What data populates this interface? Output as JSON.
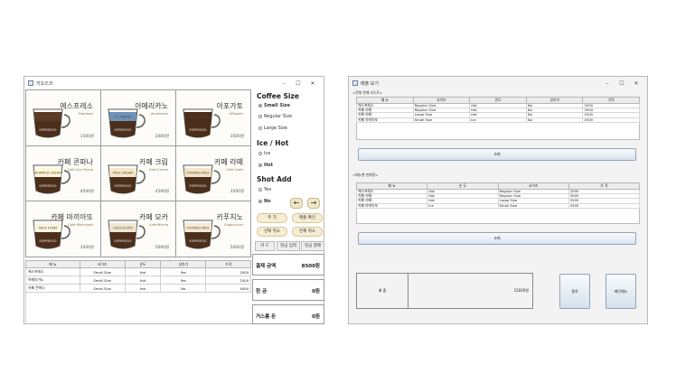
{
  "kiosk": {
    "title": "키오스크",
    "menu": [
      {
        "name": "에스프레소",
        "eng": "Espresso",
        "price": "1500원",
        "cup_label": "HYPHEN",
        "cup_top": "#5a3a22"
      },
      {
        "name": "아메리카노",
        "eng": "Americano",
        "price": "2000원",
        "cup_label": "ICE WATER",
        "cup_top": "#6e93b8"
      },
      {
        "name": "아포가토",
        "eng": "Affogato",
        "price": "3500원",
        "cup_label": "ICE CREAM",
        "cup_top": "#4a2e1b"
      },
      {
        "name": "카페 콘파나",
        "eng": "Cafe Con Panna",
        "price": "4500원",
        "cup_label": "WHIPPED CREAM",
        "cup_top": "#fff7d6"
      },
      {
        "name": "카페 크림",
        "eng": "Cafe Creme",
        "price": "4500원",
        "cup_label": "MILK CREAM",
        "cup_top": "#f5e7c7"
      },
      {
        "name": "카페 라떼",
        "eng": "Cafe Latte",
        "price": "3500원",
        "cup_label": "FOAMED MILK",
        "cup_top": "#f3e4c4"
      },
      {
        "name": "카페 마끼아또",
        "eng": "Cafe Macchiato",
        "price": "3500원",
        "cup_label": "MILK FOAM",
        "cup_top": "#faf3e2"
      },
      {
        "name": "카페 모카",
        "eng": "Cafe Mocha",
        "price": "5000원",
        "cup_label": "CHOCOLATE",
        "cup_top": "#f0e6d2"
      },
      {
        "name": "카푸치노",
        "eng": "Cappuccino",
        "price": "5000원",
        "cup_label": "FOAMED MILK",
        "cup_top": "#f5e9d6"
      }
    ],
    "cup_base_label": "ESPRESSO",
    "options": {
      "size_title": "Coffee Size",
      "sizes": [
        {
          "label": "Small Size",
          "selected": true
        },
        {
          "label": "Regular Size",
          "selected": false
        },
        {
          "label": "Large Size",
          "selected": false
        }
      ],
      "temp_title": "Ice / Hot",
      "temps": [
        {
          "label": "Ice",
          "selected": false
        },
        {
          "label": "Hot",
          "selected": true
        }
      ],
      "shot_title": "Shot Add",
      "shots": [
        {
          "label": "Yes",
          "selected": false
        },
        {
          "label": "No",
          "selected": true
        }
      ]
    },
    "buttons": {
      "prev": "←",
      "next": "→",
      "add": "추 가",
      "sales_check": "매출 확인",
      "cancel_selected": "선택 취소",
      "cancel_all": "전체 취소",
      "card": "카 드",
      "cash_input": "현금 입력",
      "cash_pay": "현금 결제"
    },
    "order_columns": [
      "메 뉴",
      "사이즈",
      "온도",
      "샷추가",
      "가격"
    ],
    "orders": [
      [
        "에스프레소",
        "Small Size",
        "Hot",
        "Yes",
        "2000"
      ],
      [
        "아메리카노",
        "Small Size",
        "Hot",
        "Yes",
        "2500"
      ],
      [
        "카페 콘파나",
        "Small Size",
        "Hot",
        "No",
        "4000"
      ]
    ],
    "summary": {
      "payment_label": "결제 금액",
      "payment_value": "8500원",
      "cash_label": "현 금",
      "cash_value": "0원",
      "change_label": "거스름 돈",
      "change_value": "0원"
    }
  },
  "sales": {
    "title": "매출 보기",
    "all_sales_title": "<전체 판매 리스트>",
    "all_columns": [
      "메 뉴",
      "사이즈",
      "온도",
      "샷추가",
      "가격"
    ],
    "all_rows": [
      [
        "에스프레소",
        "Regular Size",
        "Hot",
        "No",
        "2000"
      ],
      [
        "카페 라떼",
        "Regular Size",
        "Hot",
        "No",
        "3000"
      ],
      [
        "카페 라떼",
        "Large Size",
        "Hot",
        "No",
        "2500"
      ],
      [
        "카페 마끼아또",
        "Small Size",
        "Ice",
        "No",
        "4500"
      ]
    ],
    "query_button": "조회",
    "menu_sales_title": "<메뉴별 판매량>",
    "menu_columns": [
      "메 뉴",
      "온 도",
      "사이즈",
      "가 격"
    ],
    "menu_rows": [
      [
        "에스프레소",
        "Hot",
        "Regular Size",
        "2000"
      ],
      [
        "카페 라떼",
        "Hot",
        "Regular Size",
        "3000"
      ],
      [
        "카페 라떼",
        "Hot",
        "Large Size",
        "2500"
      ],
      [
        "카페 마끼아또",
        "Ice",
        "Small Size",
        "4500"
      ]
    ],
    "query_button2": "조회",
    "total_label": "매 출",
    "total_value": "15000원",
    "close_button": "종료",
    "back_button": "메인메뉴"
  }
}
